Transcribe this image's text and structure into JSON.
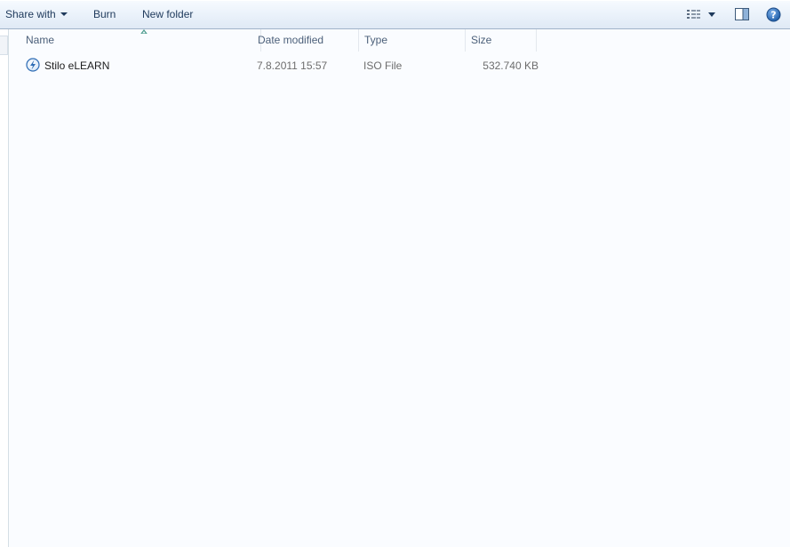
{
  "toolbar": {
    "share_with_label": "Share with",
    "burn_label": "Burn",
    "new_folder_label": "New folder"
  },
  "columns": {
    "name": "Name",
    "date_modified": "Date modified",
    "type": "Type",
    "size": "Size"
  },
  "files": [
    {
      "name": "Stilo eLEARN",
      "date_modified": "7.8.2011 15:57",
      "type": "ISO File",
      "size": "532.740 KB",
      "icon": "iso-disc-icon"
    }
  ],
  "colors": {
    "toolbar_text": "#1e395b",
    "header_text": "#4c607a",
    "help_blue": "#2c6fbf",
    "sort_arrow": "#4a9a8c"
  }
}
